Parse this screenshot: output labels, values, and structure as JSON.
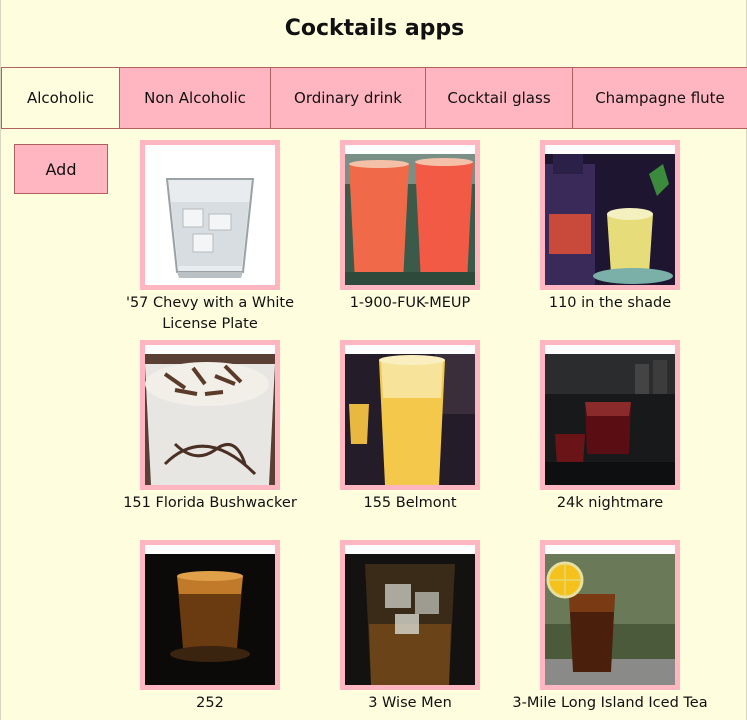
{
  "app": {
    "title": "Cocktails apps"
  },
  "tabs": [
    {
      "label": "Alcoholic",
      "active": true
    },
    {
      "label": "Non Alcoholic",
      "active": false
    },
    {
      "label": "Ordinary drink",
      "active": false
    },
    {
      "label": "Cocktail glass",
      "active": false
    },
    {
      "label": "Champagne flute",
      "active": false
    }
  ],
  "actions": {
    "add_label": "Add"
  },
  "drinks": [
    {
      "name": "'57 Chevy with a White License Plate"
    },
    {
      "name": "1-900-FUK-MEUP"
    },
    {
      "name": "110 in the shade"
    },
    {
      "name": "151 Florida Bushwacker"
    },
    {
      "name": "155 Belmont"
    },
    {
      "name": "24k nightmare"
    },
    {
      "name": "252"
    },
    {
      "name": "3 Wise Men"
    },
    {
      "name": "3-Mile Long Island Iced Tea"
    }
  ],
  "colors": {
    "background": "#fefedf",
    "accent": "#ffb6c1",
    "border": "#b06060"
  }
}
